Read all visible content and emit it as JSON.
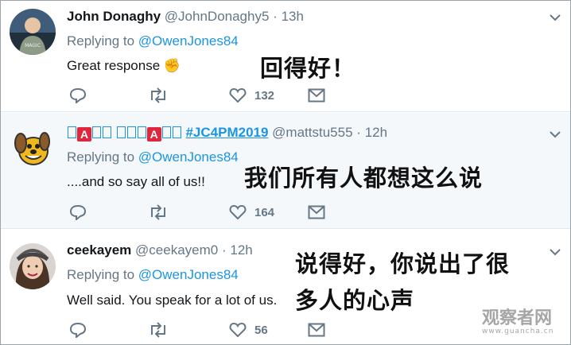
{
  "tweets": [
    {
      "name": "John Donaghy",
      "handle": "@JohnDonaghy5",
      "dot": "·",
      "time": "13h",
      "replying_label": "Replying to",
      "replying_to": "@OwenJones84",
      "text": "Great response",
      "text_emoji": "✊",
      "like_count": "132",
      "caption": "回得好！"
    },
    {
      "name_prefix": "",
      "name_mark": "A",
      "name_hashtag": "#JC4PM2019",
      "handle": "@mattstu555",
      "dot": "·",
      "time": "12h",
      "replying_label": "Replying to",
      "replying_to": "@OwenJones84",
      "text": "....and so say all of us!!",
      "like_count": "164",
      "caption": "我们所有人都想这么说"
    },
    {
      "name": "ceekayem",
      "handle": "@ceekayem0",
      "dot": "·",
      "time": "12h",
      "replying_label": "Replying to",
      "replying_to": "@OwenJones84",
      "text": "Well said. You speak for a lot of us.",
      "like_count": "56",
      "caption_line1": "说得好，你说出了很",
      "caption_line2": "多人的心声"
    }
  ],
  "watermark": {
    "text": "观察者网",
    "sub": "www.guancha.cn"
  },
  "colors": {
    "link": "#1b95e0",
    "muted": "#657786",
    "highlight_bg": "#f5f8fa"
  },
  "icons": [
    "reply-icon",
    "retweet-icon",
    "like-icon",
    "dm-icon",
    "caret-down-icon"
  ]
}
